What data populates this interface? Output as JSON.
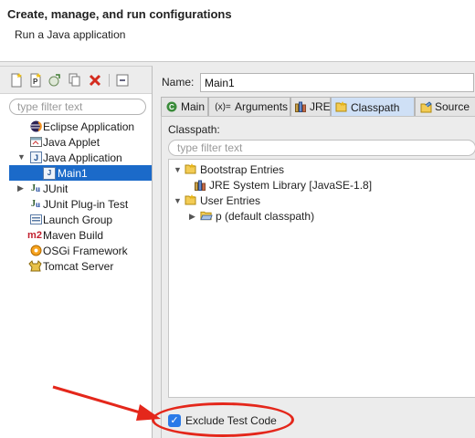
{
  "header": {
    "title": "Create, manage, and run configurations",
    "subtitle": "Run a Java application"
  },
  "left": {
    "filter_placeholder": "type filter text",
    "items": [
      {
        "label": "Eclipse Application",
        "icon": "eclipse-icon"
      },
      {
        "label": "Java Applet",
        "icon": "applet-icon"
      },
      {
        "label": "Java Application",
        "icon": "java-app-icon",
        "expanded": true
      },
      {
        "label": "Main1",
        "icon": "java-class-icon",
        "selected": true
      },
      {
        "label": "JUnit",
        "icon": "junit-icon"
      },
      {
        "label": "JUnit Plug-in Test",
        "icon": "junit-plugin-icon"
      },
      {
        "label": "Launch Group",
        "icon": "launch-group-icon"
      },
      {
        "label": "Maven Build",
        "icon": "maven-icon",
        "prefix": "m2"
      },
      {
        "label": "OSGi Framework",
        "icon": "osgi-icon"
      },
      {
        "label": "Tomcat Server",
        "icon": "tomcat-icon"
      }
    ]
  },
  "right": {
    "name_label": "Name:",
    "name_value": "Main1",
    "tabs": [
      {
        "label": "Main",
        "icon": "main-tab-icon"
      },
      {
        "label": "Arguments",
        "icon": "arguments-icon",
        "prefix": "(x)="
      },
      {
        "label": "JRE",
        "icon": "jre-icon"
      },
      {
        "label": "Classpath",
        "icon": "classpath-icon",
        "active": true
      },
      {
        "label": "Source",
        "icon": "source-icon"
      }
    ],
    "classpath_label": "Classpath:",
    "filter_placeholder": "type filter text",
    "entries": [
      {
        "label": "Bootstrap Entries"
      },
      {
        "label": "JRE System Library [JavaSE-1.8]"
      },
      {
        "label": "User Entries"
      },
      {
        "label": "p (default classpath)"
      }
    ],
    "exclude_label": "Exclude Test Code",
    "exclude_checked": true
  },
  "colors": {
    "selection": "#1b6ac9",
    "annotation": "#e4271b",
    "checkbox": "#2a7ae8"
  }
}
